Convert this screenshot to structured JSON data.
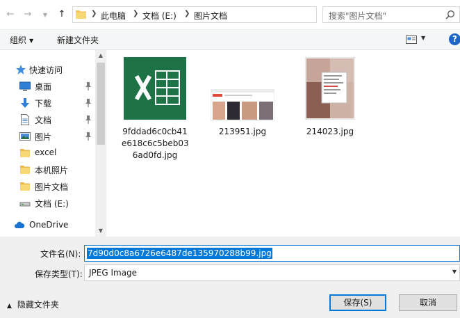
{
  "address": {
    "breadcrumbs": [
      "此电脑",
      "文档 (E:)",
      "图片文档"
    ],
    "search_placeholder": "搜索\"图片文档\""
  },
  "toolbar": {
    "organize_label": "组织",
    "new_folder_label": "新建文件夹"
  },
  "nav": {
    "quick_access": "快速访问",
    "items": [
      {
        "label": "桌面",
        "icon": "desktop-icon",
        "pinned": true
      },
      {
        "label": "下载",
        "icon": "download-icon",
        "pinned": true
      },
      {
        "label": "文档",
        "icon": "document-icon",
        "pinned": true
      },
      {
        "label": "图片",
        "icon": "pictures-icon",
        "pinned": true
      },
      {
        "label": "excel",
        "icon": "folder-icon",
        "pinned": false
      },
      {
        "label": "本机照片",
        "icon": "folder-icon",
        "pinned": false
      },
      {
        "label": "图片文档",
        "icon": "folder-icon",
        "pinned": false
      },
      {
        "label": "文档 (E:)",
        "icon": "drive-icon",
        "pinned": false
      }
    ],
    "onedrive": "OneDrive"
  },
  "files": [
    {
      "name_lines": [
        "9fddad6c0cb41",
        "e618c6c5beb03",
        "6ad0fd.jpg"
      ],
      "thumb": "excel-icon"
    },
    {
      "name_lines": [
        "213951.jpg"
      ],
      "thumb": "image-thumbnail"
    },
    {
      "name_lines": [
        "214023.jpg"
      ],
      "thumb": "image-thumbnail"
    }
  ],
  "form": {
    "filename_label": "文件名(N):",
    "filename_value": "7d90d0c8a6726e6487de135970288b99.jpg",
    "filetype_label": "保存类型(T):",
    "filetype_value": "JPEG Image",
    "hide_folders_label": "隐藏文件夹",
    "save_label": "保存(S)",
    "cancel_label": "取消"
  },
  "colors": {
    "accent": "#0078d7",
    "help": "#1c66c8",
    "excel_green": "#1d7346"
  }
}
